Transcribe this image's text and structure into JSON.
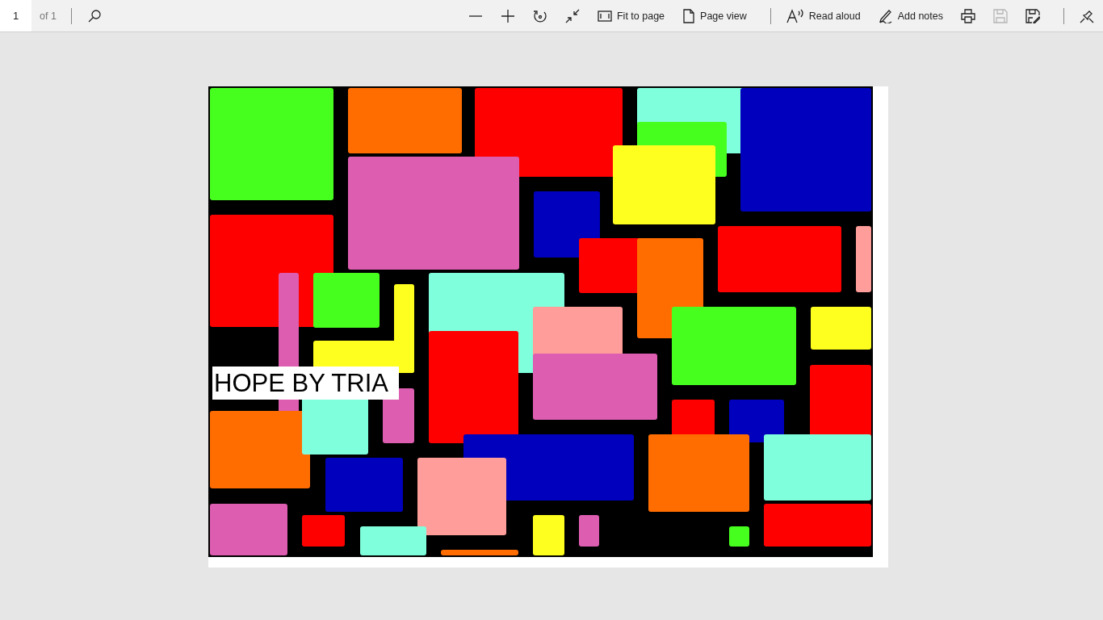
{
  "toolbar": {
    "page_number": "1",
    "page_count": "of 1",
    "left_tools": [
      {
        "kind": "search",
        "disabled": false
      }
    ],
    "right_tools": [
      {
        "kind": "zoom-out",
        "disabled": false
      },
      {
        "kind": "zoom-in",
        "disabled": false
      },
      {
        "kind": "rotate",
        "disabled": false
      },
      {
        "kind": "collapse",
        "disabled": false
      },
      {
        "kind": "fit",
        "label": "Fit to page",
        "disabled": false
      },
      {
        "kind": "pageview",
        "label": "Page view",
        "disabled": false
      },
      {
        "kind": "divider"
      },
      {
        "kind": "read",
        "label": "Read aloud",
        "disabled": false
      },
      {
        "kind": "notes",
        "label": "Add notes",
        "disabled": false
      },
      {
        "kind": "print",
        "disabled": false
      },
      {
        "kind": "save",
        "disabled": true
      },
      {
        "kind": "saveas",
        "disabled": false
      },
      {
        "kind": "divider"
      },
      {
        "kind": "pin",
        "disabled": false
      }
    ]
  },
  "document": {
    "caption": "HOPE BY TRIA"
  }
}
